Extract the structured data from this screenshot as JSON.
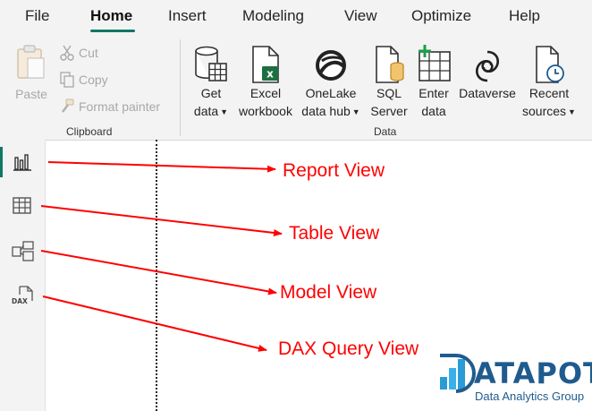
{
  "menu": {
    "tabs": [
      {
        "label": "File"
      },
      {
        "label": "Home"
      },
      {
        "label": "Insert"
      },
      {
        "label": "Modeling"
      },
      {
        "label": "View"
      },
      {
        "label": "Optimize"
      },
      {
        "label": "Help"
      }
    ],
    "active": "Home"
  },
  "clipboard": {
    "paste": "Paste",
    "cut": "Cut",
    "copy": "Copy",
    "format_painter": "Format painter",
    "group_label": "Clipboard"
  },
  "data_group": {
    "get_data": [
      "Get",
      "data"
    ],
    "excel": [
      "Excel",
      "workbook"
    ],
    "onelake": [
      "OneLake",
      "data hub"
    ],
    "sql": [
      "SQL",
      "Server"
    ],
    "enter": [
      "Enter",
      "data"
    ],
    "dataverse": [
      "Dataverse"
    ],
    "recent": [
      "Recent",
      "sources"
    ],
    "group_label": "Data"
  },
  "sidebar": {
    "report_icon": "bar-chart-icon",
    "table_icon": "table-grid-icon",
    "model_icon": "model-diagram-icon",
    "dax_icon": "dax-query-icon",
    "dax_text": "DAX"
  },
  "callouts": {
    "report": "Report View",
    "table": "Table View",
    "model": "Model View",
    "dax": "DAX Query View"
  },
  "logo": {
    "word": "ATAPOT",
    "sub": "Data Analytics Group"
  },
  "colors": {
    "accent": "#117865",
    "annotation": "#ff0000",
    "excel_green": "#1d6f42",
    "logo_blue": "#1f5b8f"
  }
}
